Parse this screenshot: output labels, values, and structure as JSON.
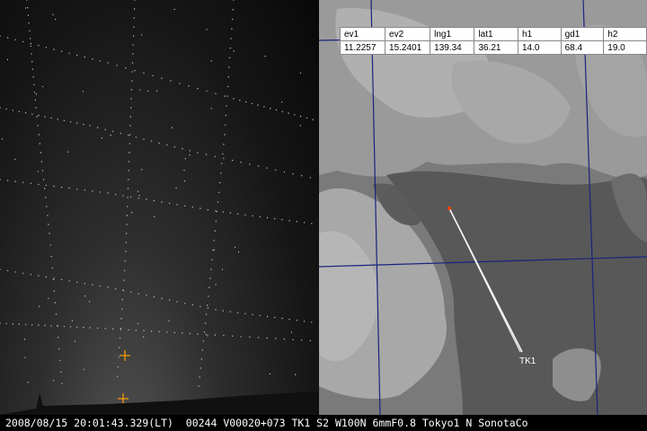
{
  "table": {
    "headers": [
      "ev1",
      "ev2",
      "lng1",
      "lat1",
      "h1",
      "gd1",
      "h2"
    ],
    "values": [
      "11.2257",
      "15.2401",
      "139.34",
      "36.21",
      "14.0",
      "68.4",
      "19.0"
    ]
  },
  "map": {
    "station_label": "TK1"
  },
  "status_bar": {
    "text": "2008/08/15 20:01:43.329(LT)  00244 V00020+073 TK1 S2 W100N 6mmF0.8 Tokyo1 N SonotaCo"
  },
  "colors": {
    "grid_line": "#1a237e",
    "marker": "#ffa000",
    "track_line": "#ffffff",
    "track_start": "#ff4400"
  }
}
